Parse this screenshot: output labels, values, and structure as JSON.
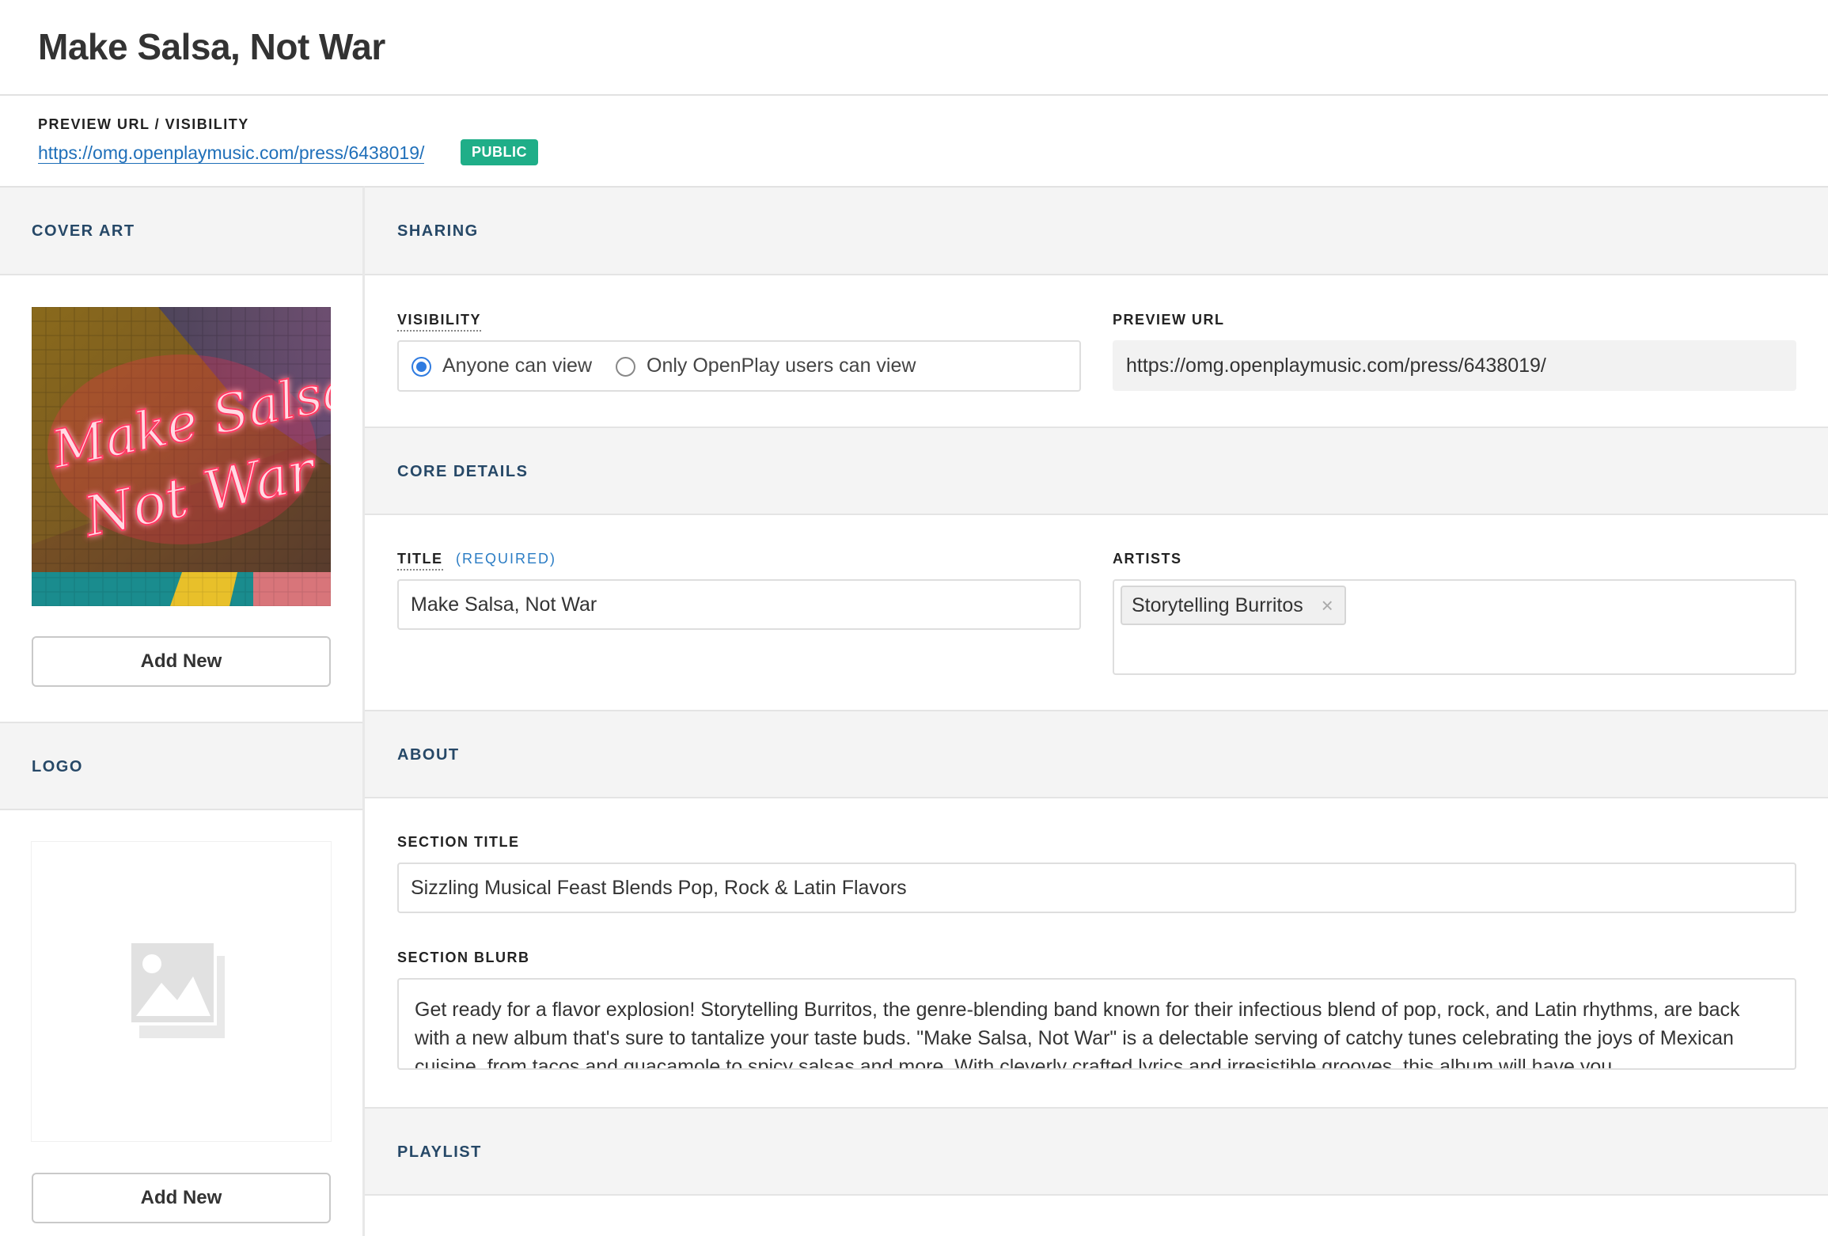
{
  "header": {
    "title": "Make Salsa, Not War"
  },
  "preview": {
    "label": "PREVIEW URL / VISIBILITY",
    "url": "https://omg.openplaymusic.com/press/6438019/",
    "badge": "PUBLIC"
  },
  "left": {
    "cover_art": {
      "heading": "COVER ART",
      "art_text_line1": "Make Salsa",
      "art_text_line2": "Not War",
      "button": "Add New"
    },
    "logo": {
      "heading": "LOGO",
      "button": "Add New",
      "placeholder_icon": "image-placeholder-icon"
    }
  },
  "sharing": {
    "heading": "SHARING",
    "visibility_label": "VISIBILITY",
    "options": [
      {
        "label": "Anyone can view",
        "checked": true
      },
      {
        "label": "Only OpenPlay users can view",
        "checked": false
      }
    ],
    "preview_url_label": "PREVIEW URL",
    "preview_url_value": "https://omg.openplaymusic.com/press/6438019/"
  },
  "core": {
    "heading": "CORE DETAILS",
    "title_label": "TITLE",
    "required": "(REQUIRED)",
    "title_value": "Make Salsa, Not War",
    "artists_label": "ARTISTS",
    "artists": [
      "Storytelling Burritos"
    ]
  },
  "about": {
    "heading": "ABOUT",
    "section_title_label": "SECTION TITLE",
    "section_title_value": "Sizzling Musical Feast Blends Pop, Rock & Latin Flavors",
    "section_blurb_label": "SECTION BLURB",
    "section_blurb_value": "Get ready for a flavor explosion! Storytelling Burritos, the genre-blending band known for their infectious blend of pop, rock, and Latin rhythms, are back with a new album that's sure to tantalize your taste buds. \"Make Salsa, Not War\" is a delectable serving of catchy tunes celebrating the joys of Mexican cuisine, from tacos and guacamole to spicy salsas and more. With cleverly crafted lyrics and irresistible grooves, this album will have you"
  },
  "playlist": {
    "heading": "PLAYLIST"
  },
  "colors": {
    "accent_blue": "#1f6fb9",
    "badge_green": "#1fae88",
    "section_heading": "#264867",
    "section_bg": "#f4f4f4"
  }
}
